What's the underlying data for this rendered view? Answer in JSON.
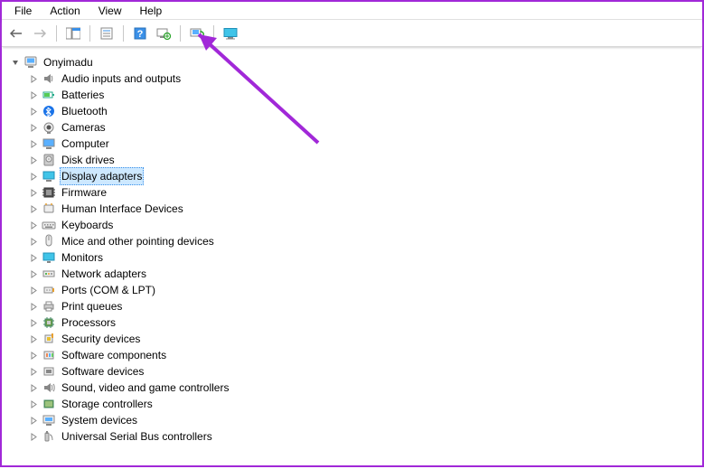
{
  "menubar": {
    "file": "File",
    "action": "Action",
    "view": "View",
    "help": "Help"
  },
  "toolbar_icons": {
    "back": "back-icon",
    "forward": "forward-icon",
    "show_hide": "show-hide-tree-icon",
    "properties": "properties-icon",
    "help": "help-icon",
    "scan": "scan-hardware-icon",
    "update": "update-driver-icon",
    "monitor": "monitor-icon"
  },
  "tree": {
    "root": "Onyimadu",
    "selected_index": 6,
    "items": [
      {
        "label": "Audio inputs and outputs",
        "icon": "speaker"
      },
      {
        "label": "Batteries",
        "icon": "battery"
      },
      {
        "label": "Bluetooth",
        "icon": "bluetooth"
      },
      {
        "label": "Cameras",
        "icon": "camera"
      },
      {
        "label": "Computer",
        "icon": "computer"
      },
      {
        "label": "Disk drives",
        "icon": "disk"
      },
      {
        "label": "Display adapters",
        "icon": "display"
      },
      {
        "label": "Firmware",
        "icon": "firmware"
      },
      {
        "label": "Human Interface Devices",
        "icon": "hid"
      },
      {
        "label": "Keyboards",
        "icon": "keyboard"
      },
      {
        "label": "Mice and other pointing devices",
        "icon": "mouse"
      },
      {
        "label": "Monitors",
        "icon": "monitor"
      },
      {
        "label": "Network adapters",
        "icon": "network"
      },
      {
        "label": "Ports (COM & LPT)",
        "icon": "port"
      },
      {
        "label": "Print queues",
        "icon": "printer"
      },
      {
        "label": "Processors",
        "icon": "cpu"
      },
      {
        "label": "Security devices",
        "icon": "security"
      },
      {
        "label": "Software components",
        "icon": "swcomp"
      },
      {
        "label": "Software devices",
        "icon": "swdev"
      },
      {
        "label": "Sound, video and game controllers",
        "icon": "sound"
      },
      {
        "label": "Storage controllers",
        "icon": "storage"
      },
      {
        "label": "System devices",
        "icon": "system"
      },
      {
        "label": "Universal Serial Bus controllers",
        "icon": "usb"
      }
    ]
  },
  "annotation": {
    "arrow_color": "#a128d8"
  }
}
